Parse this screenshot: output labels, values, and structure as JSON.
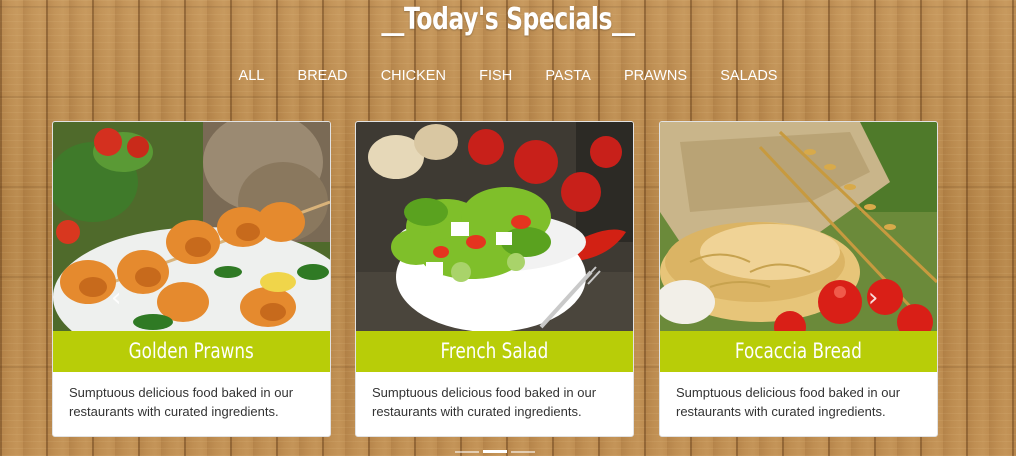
{
  "header": {
    "title": "__Today's Specials__"
  },
  "filters": [
    "ALL",
    "BREAD",
    "CHICKEN",
    "FISH",
    "PASTA",
    "PRAWNS",
    "SALADS"
  ],
  "cards": [
    {
      "name": "Golden Prawns",
      "description": "Sumptuous delicious food baked in our restaurants with curated ingredients."
    },
    {
      "name": "French Salad",
      "description": "Sumptuous delicious food baked in our restaurants with curated ingredients."
    },
    {
      "name": "Focaccia Bread",
      "description": "Sumptuous delicious food baked in our restaurants with curated ingredients."
    }
  ],
  "carousel": {
    "prev_icon": "chevron-left-icon",
    "next_icon": "chevron-right-icon",
    "slides": 3,
    "active_slide": 2
  },
  "colors": {
    "accent": "#b8cd08",
    "card_bg": "#ffffff",
    "text": "#333333",
    "wood": "#b98a4e"
  }
}
